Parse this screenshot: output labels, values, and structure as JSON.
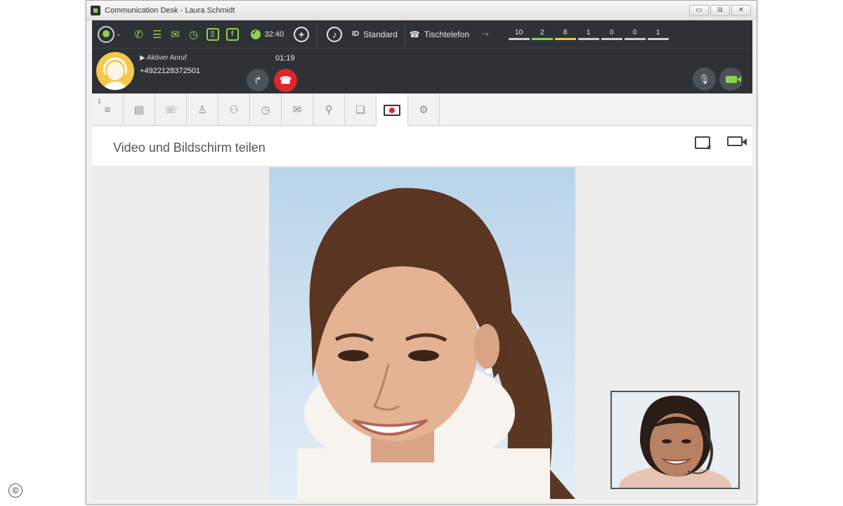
{
  "window": {
    "title": "Communication Desk - ",
    "user": "Laura Schmidt",
    "controls": [
      "▭",
      "⧉",
      "✕"
    ]
  },
  "toolbar": {
    "status_time": "32:40",
    "id_label": "ID",
    "profile": "Standard",
    "device": "Tischtelefon",
    "counters": [
      {
        "value": "10",
        "color": "#d0d0d0"
      },
      {
        "value": "2",
        "color": "#8fd14f"
      },
      {
        "value": "8",
        "color": "#f2c94c"
      },
      {
        "value": "1",
        "color": "#d0d0d0"
      },
      {
        "value": "0",
        "color": "#d0d0d0"
      },
      {
        "value": "0",
        "color": "#d0d0d0"
      },
      {
        "value": "1",
        "color": "#d0d0d0"
      }
    ]
  },
  "call": {
    "label": "Aktiver Anruf",
    "number": "+4922128372501",
    "duration": "01:19"
  },
  "tabs": {
    "queue_badge": "1"
  },
  "section": {
    "title": "Video und Bildschirm teilen"
  },
  "colors": {
    "accent_green": "#8fd14f",
    "hangup_red": "#e0262c",
    "dark_bar": "#2e3237"
  },
  "footer": {
    "copyright": "©"
  }
}
